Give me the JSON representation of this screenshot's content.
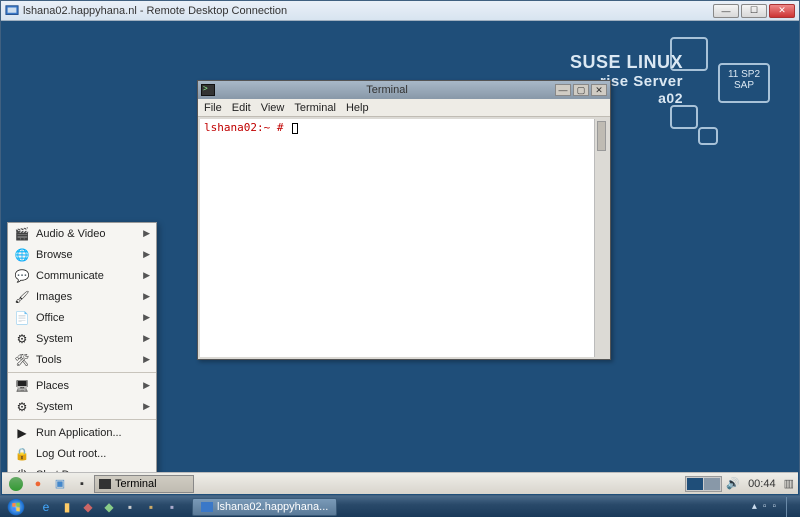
{
  "rdp": {
    "title": "lshana02.happyhana.nl - Remote Desktop Connection"
  },
  "branding": {
    "line1": "SUSE LINUX",
    "line2": "rise Server",
    "line3": "a02",
    "badge_line1": "11 SP2",
    "badge_line2": "SAP"
  },
  "terminal": {
    "title": "Terminal",
    "menus": {
      "file": "File",
      "edit": "Edit",
      "view": "View",
      "terminal": "Terminal",
      "help": "Help"
    },
    "prompt": "lshana02:~ #"
  },
  "start_menu": {
    "groups": [
      {
        "icon": "🎬",
        "label": "Audio & Video",
        "sub": true
      },
      {
        "icon": "🌐",
        "label": "Browse",
        "sub": true
      },
      {
        "icon": "💬",
        "label": "Communicate",
        "sub": true
      },
      {
        "icon": "🖌",
        "label": "Images",
        "sub": true
      },
      {
        "icon": "📄",
        "label": "Office",
        "sub": true
      },
      {
        "icon": "⚙",
        "label": "System",
        "sub": true
      },
      {
        "icon": "🛠",
        "label": "Tools",
        "sub": true
      }
    ],
    "places": [
      {
        "icon": "🖥",
        "label": "Places",
        "sub": true
      },
      {
        "icon": "⚙",
        "label": "System",
        "sub": true
      }
    ],
    "actions": [
      {
        "icon": "▶",
        "label": "Run Application..."
      },
      {
        "icon": "🔒",
        "label": "Log Out root..."
      },
      {
        "icon": "⏻",
        "label": "Shut Down..."
      }
    ]
  },
  "linux_taskbar": {
    "task_label": "Terminal",
    "clock": "00:44"
  },
  "windows_taskbar": {
    "task_label": "lshana02.happyhana..."
  }
}
